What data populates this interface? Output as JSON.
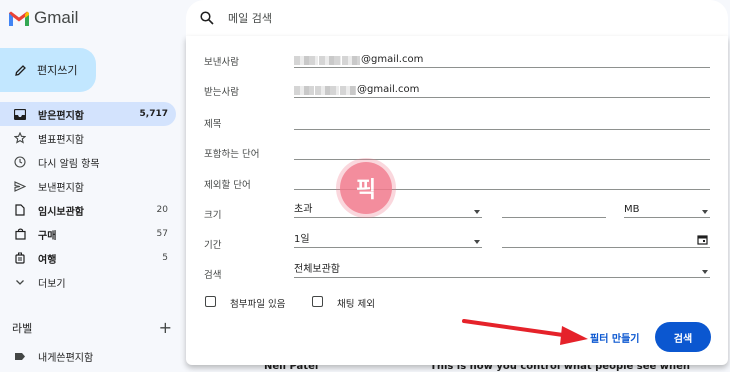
{
  "app": {
    "name": "Gmail"
  },
  "sidebar": {
    "compose_label": "편지쓰기",
    "items": [
      {
        "label": "받은편지함",
        "count": "5,717",
        "icon": "inbox-icon"
      },
      {
        "label": "별표편지함",
        "count": "",
        "icon": "star-icon"
      },
      {
        "label": "다시 알림 항목",
        "count": "",
        "icon": "clock-icon"
      },
      {
        "label": "보낸편지함",
        "count": "",
        "icon": "send-icon"
      },
      {
        "label": "임시보관함",
        "count": "20",
        "icon": "draft-icon"
      },
      {
        "label": "구매",
        "count": "57",
        "icon": "shopping-bag-icon"
      },
      {
        "label": "여행",
        "count": "5",
        "icon": "luggage-icon"
      },
      {
        "label": "더보기",
        "count": "",
        "icon": "chevron-down-icon"
      }
    ],
    "labels_title": "라벨",
    "labels_add": "+",
    "label_items": [
      {
        "label": "내게쓴편지함"
      }
    ]
  },
  "search": {
    "placeholder": "메일 검색"
  },
  "filter": {
    "from_label": "보낸사람",
    "from_value_suffix": "@gmail.com",
    "to_label": "받는사람",
    "to_value_suffix": "@gmail.com",
    "subject_label": "제목",
    "has_words_label": "포함하는 단어",
    "not_words_label": "제외할 단어",
    "size_label": "크기",
    "size_op": "초과",
    "size_unit": "MB",
    "date_label": "기간",
    "date_range": "1일",
    "search_in_label": "검색",
    "search_in_value": "전체보관함",
    "has_attachment": "첨부파일 있음",
    "exclude_chats": "채팅 제외",
    "create_filter": "필터 만들기",
    "search_button": "검색"
  },
  "stamp_text": "픽",
  "background_row": {
    "sender": "Neil Patel",
    "subject": "This is how you control what people see when Googling you"
  },
  "colors": {
    "accent": "#0b57d0",
    "compose_bg": "#c2e7ff",
    "active_bg": "#d3e3fd",
    "arrow": "#e5222a",
    "stamp": "#f27a8c"
  }
}
